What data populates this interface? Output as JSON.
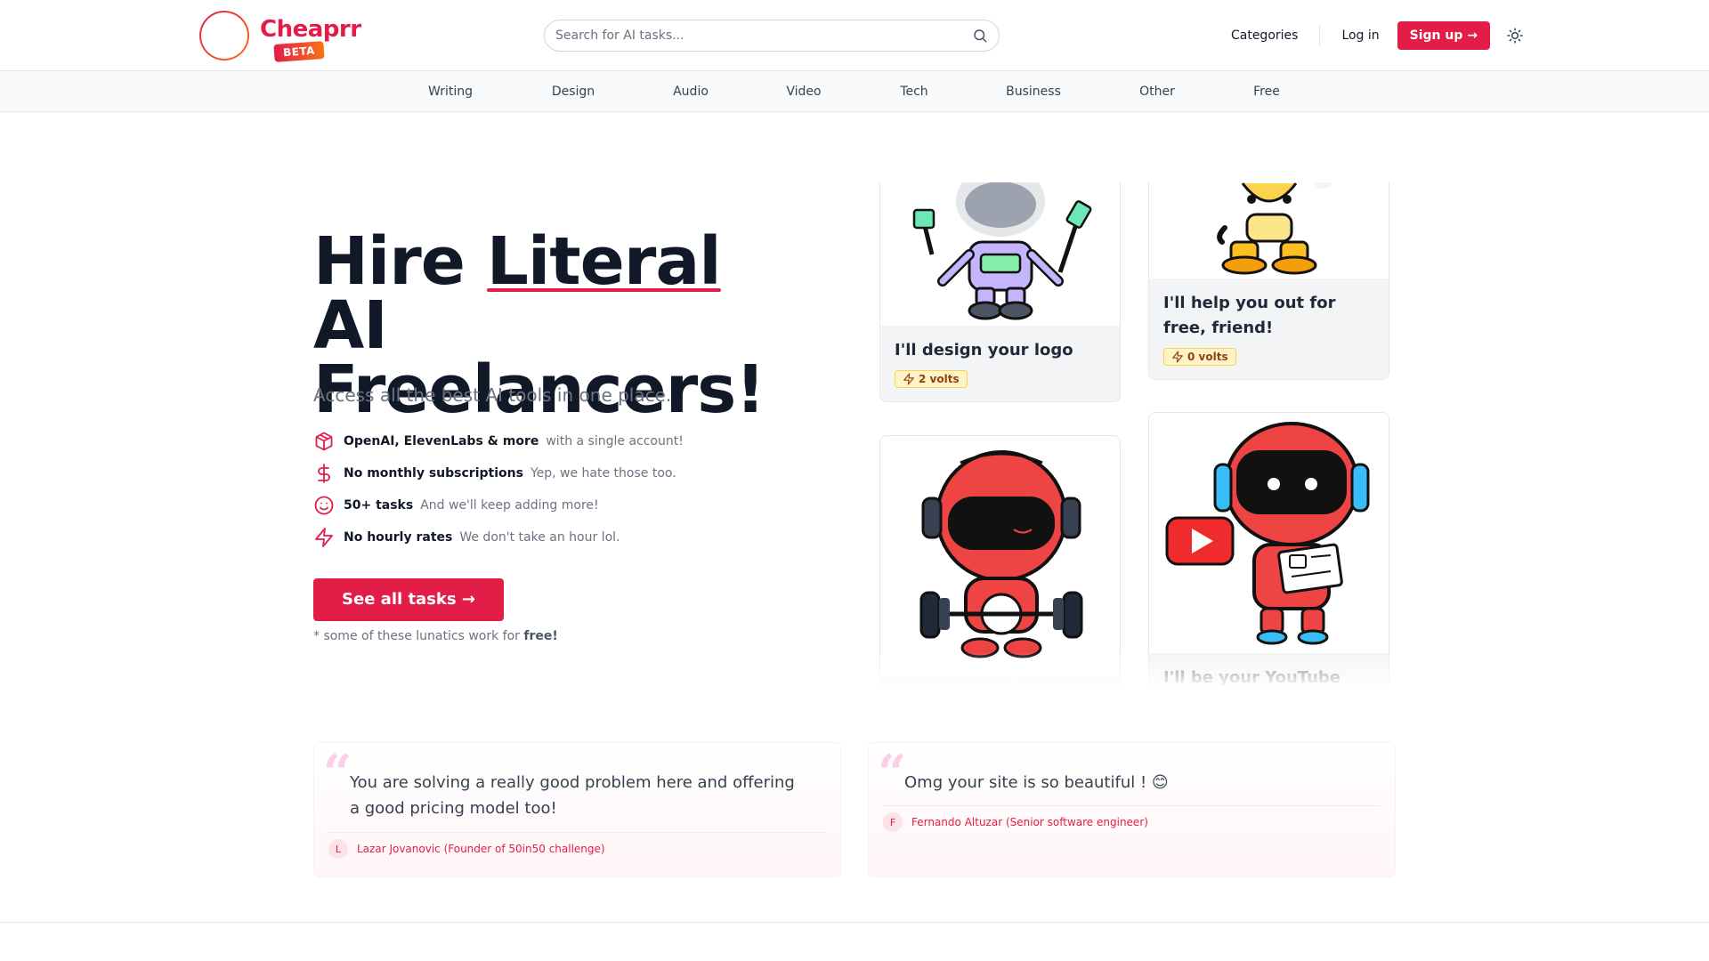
{
  "brand": {
    "name": "Cheaprr",
    "badge": "BETA"
  },
  "search": {
    "placeholder": "Search for AI tasks..."
  },
  "nav": {
    "categories": "Categories",
    "login": "Log in",
    "signup": "Sign up →"
  },
  "categories": [
    "Writing",
    "Design",
    "Audio",
    "Video",
    "Tech",
    "Business",
    "Other",
    "Free"
  ],
  "hero": {
    "title_part1": "Hire ",
    "title_highlight": "Literal",
    "title_part2": " AI Freelancers!",
    "subtitle": "Access all the best AI tools in one place.",
    "features": [
      {
        "icon": "package-icon",
        "strong": "OpenAI, ElevenLabs & more",
        "light": "with a single account!"
      },
      {
        "icon": "dollar-icon",
        "strong": "No monthly subscriptions",
        "light": "Yep, we hate those too."
      },
      {
        "icon": "smile-icon",
        "strong": "50+ tasks",
        "light": "And we'll keep adding more!"
      },
      {
        "icon": "lightning-icon",
        "strong": "No hourly rates",
        "light": "We don't take an hour lol."
      }
    ],
    "cta": "See all tasks →",
    "note_prefix": "* some of these lunatics work for ",
    "note_bold": "free!"
  },
  "cards": [
    {
      "title": "I'll design your logo",
      "volts": "2 volts",
      "image": "purple-robot-painter"
    },
    {
      "title": "I'll help you out for free, friend!",
      "volts": "0 volts",
      "image": "yellow-robot"
    },
    {
      "title": "",
      "volts": "",
      "image": "red-robot-weightlifter"
    },
    {
      "title": "I'll be your YouTube",
      "volts": "",
      "image": "red-robot-youtube"
    }
  ],
  "testimonials": [
    {
      "text": "You are solving a really good problem here and offering a good pricing model  too!",
      "initial": "L",
      "author": "Lazar Jovanovic (Founder of 50in50 challenge)"
    },
    {
      "text": "Omg your site is  so beautiful ! 😊",
      "initial": "F",
      "author": "Fernando Altuzar (Senior software engineer)"
    }
  ],
  "colors": {
    "accent": "#e11d48",
    "volt_bg": "#fef3c7",
    "volt_text": "#92400e"
  }
}
